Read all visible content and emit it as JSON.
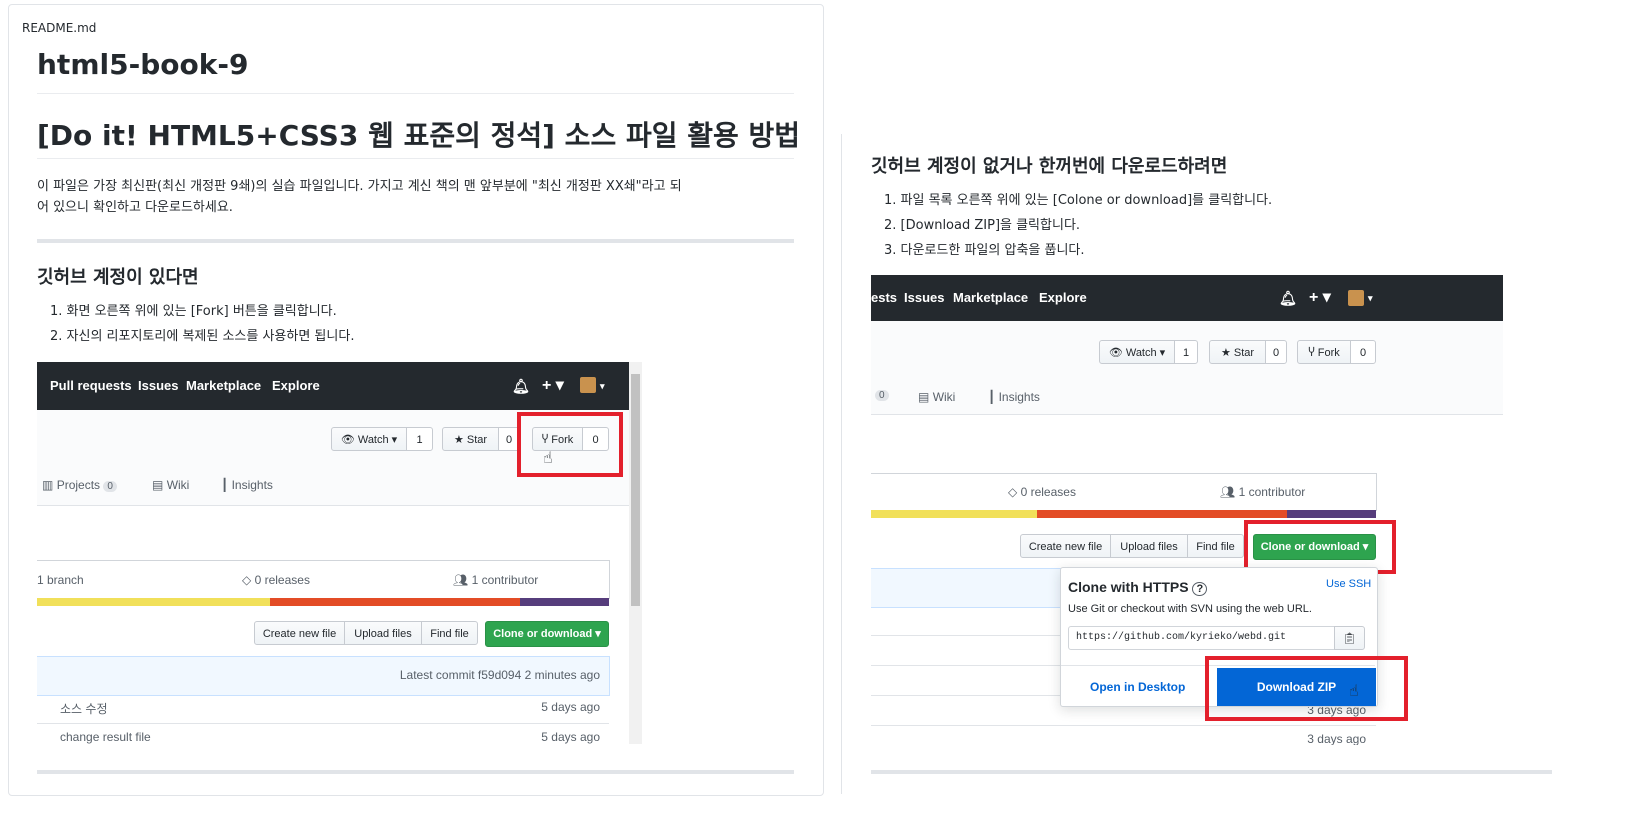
{
  "readme_label": "README.md",
  "repo_title": "html5-book-9",
  "section_title": "[Do it! HTML5+CSS3 웹 표준의 정석] 소스 파일 활용 방법",
  "intro_line1": "이 파일은 가장 최신판(최신 개정판 9쇄)의 실습 파일입니다. 가지고 계신 책의 맨 앞부분에 \"최신 개정판 XX쇄\"라고 되",
  "intro_line2": "어 있으니 확인하고 다운로드하세요.",
  "left_section": {
    "heading": "깃허브 계정이 있다면",
    "steps": [
      "1. 화면 오른쪽 위에 있는 [Fork] 버튼을 클릭합니다.",
      "2. 자신의 리포지토리에 복제된 소스를 사용하면 됩니다."
    ]
  },
  "right_section": {
    "heading": "깃허브 계정이 없거나 한꺼번에 다운로드하려면",
    "steps": [
      "1. 파일 목록 오른쪽 위에 있는 [Colone or download]를 클릭합니다.",
      "2. [Download ZIP]을 클릭합니다.",
      "3. 다운로드한 파일의 압축을 풉니다."
    ]
  },
  "shot1": {
    "nav": [
      "Pull requests",
      "Issues",
      "Marketplace",
      "Explore"
    ],
    "watch_label": "Watch ▾",
    "watch_count": "1",
    "star_label": "Star",
    "star_count": "0",
    "fork_label": "Fork",
    "fork_count": "0",
    "tabs": {
      "projects": "Projects",
      "projects_count": "0",
      "wiki": "Wiki",
      "insights": "Insights"
    },
    "summary": {
      "branch": "1 branch",
      "releases": "0 releases",
      "contributor": "1 contributor"
    },
    "buttons": {
      "create": "Create new file",
      "upload": "Upload files",
      "find": "Find file",
      "clone": "Clone or download ▾"
    },
    "latest_commit": "Latest commit f59d094 2 minutes ago",
    "rows": [
      {
        "name": "소스 수정",
        "age": "5 days ago"
      },
      {
        "name": "change result file",
        "age": "5 days ago"
      }
    ]
  },
  "shot2": {
    "nav": [
      "ests",
      "Issues",
      "Marketplace",
      "Explore"
    ],
    "watch_label": "Watch ▾",
    "watch_count": "1",
    "star_label": "Star",
    "star_count": "0",
    "fork_label": "Fork",
    "fork_count": "0",
    "tabs": {
      "count": "0",
      "wiki": "Wiki",
      "insights": "Insights"
    },
    "summary": {
      "releases": "0 releases",
      "contributor": "1 contributor"
    },
    "buttons": {
      "create": "Create new file",
      "upload": "Upload files",
      "find": "Find file",
      "clone": "Clone or download ▾"
    },
    "dropdown": {
      "title": "Clone with HTTPS",
      "use_ssh": "Use SSH",
      "desc": "Use Git or checkout with SVN using the web URL.",
      "url": "https://github.com/kyrieko/webd.git",
      "open_desktop": "Open in Desktop",
      "download_zip": "Download ZIP"
    },
    "ages": [
      "3 days ago",
      "3 days ago"
    ]
  },
  "colors": {
    "red_highlight": "#e3202c",
    "green": "#2ea44f",
    "blue": "#0366d6",
    "dark_nav": "#24292e"
  }
}
